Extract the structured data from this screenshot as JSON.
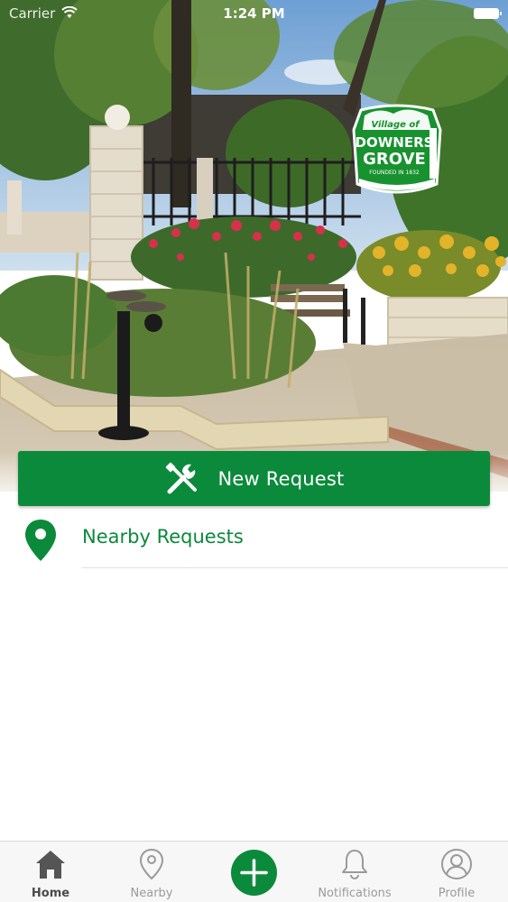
{
  "status_bar": {
    "carrier": "Carrier",
    "time": "1:24 PM"
  },
  "hero": {
    "logo": {
      "line1": "Village of",
      "line2": "DOWNERS",
      "line3": "GROVE",
      "line4": "FOUNDED IN 1832"
    }
  },
  "actions": {
    "new_request": {
      "label": "New Request",
      "icon": "tools-icon"
    },
    "nearby_requests": {
      "label": "Nearby Requests",
      "icon": "map-pin-icon"
    }
  },
  "tabs": [
    {
      "label": "Home",
      "icon": "home-icon",
      "active": true
    },
    {
      "label": "Nearby",
      "icon": "map-pin-outline-icon",
      "active": false
    },
    {
      "label": "",
      "icon": "plus-icon",
      "active": false
    },
    {
      "label": "Notifications",
      "icon": "bell-icon",
      "active": false
    },
    {
      "label": "Profile",
      "icon": "user-icon",
      "active": false
    }
  ],
  "colors": {
    "brand_green": "#0b8a3b",
    "tab_inactive": "#9a9a9a",
    "tab_active": "#4a4a4a"
  }
}
